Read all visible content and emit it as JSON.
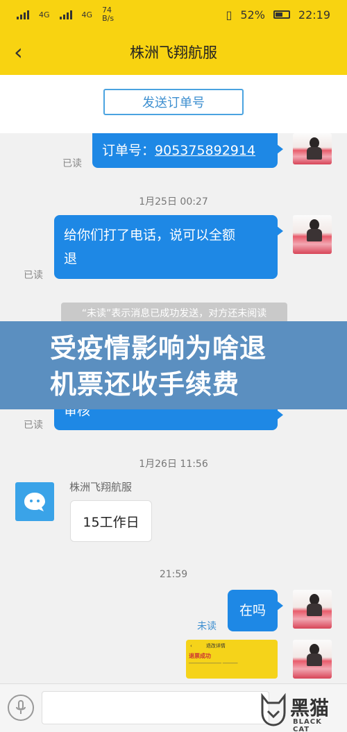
{
  "statusbar": {
    "net1": "4G",
    "net2": "4G",
    "speed_top": "74",
    "speed_unit": "B/s",
    "battery": "52%",
    "time": "22:19"
  },
  "header": {
    "title": "株洲飞翔航服"
  },
  "send_order_label": "发送订单号",
  "messages": {
    "order_prefix": "订单号：",
    "order_number": "905375892914",
    "read1": "已读",
    "time1": "1月25日 00:27",
    "call_text_line1": "给你们打了电话，说可以全额",
    "call_text_line2": "退",
    "read2": "已读",
    "tip": "“未读”表示消息已成功发送，对方还未阅读",
    "partial_text": "审核",
    "read3": "已读",
    "time2": "1月26日 11:56",
    "service_name": "株洲飞翔航服",
    "service_reply": "15工作日",
    "time3": "21:59",
    "zai_ma": "在吗",
    "unread": "未读",
    "img_header": "退改详情",
    "img_status": "退票成功"
  },
  "banner": {
    "line1": "受疫情影响为啥退",
    "line2": "机票还收手续费"
  },
  "watermark": {
    "cn": "黑猫",
    "en": "BLACK CAT"
  },
  "colors": {
    "brand_yellow": "#f8d311",
    "bubble_blue": "#1e88e5",
    "banner_blue": "#5b8fc0"
  }
}
